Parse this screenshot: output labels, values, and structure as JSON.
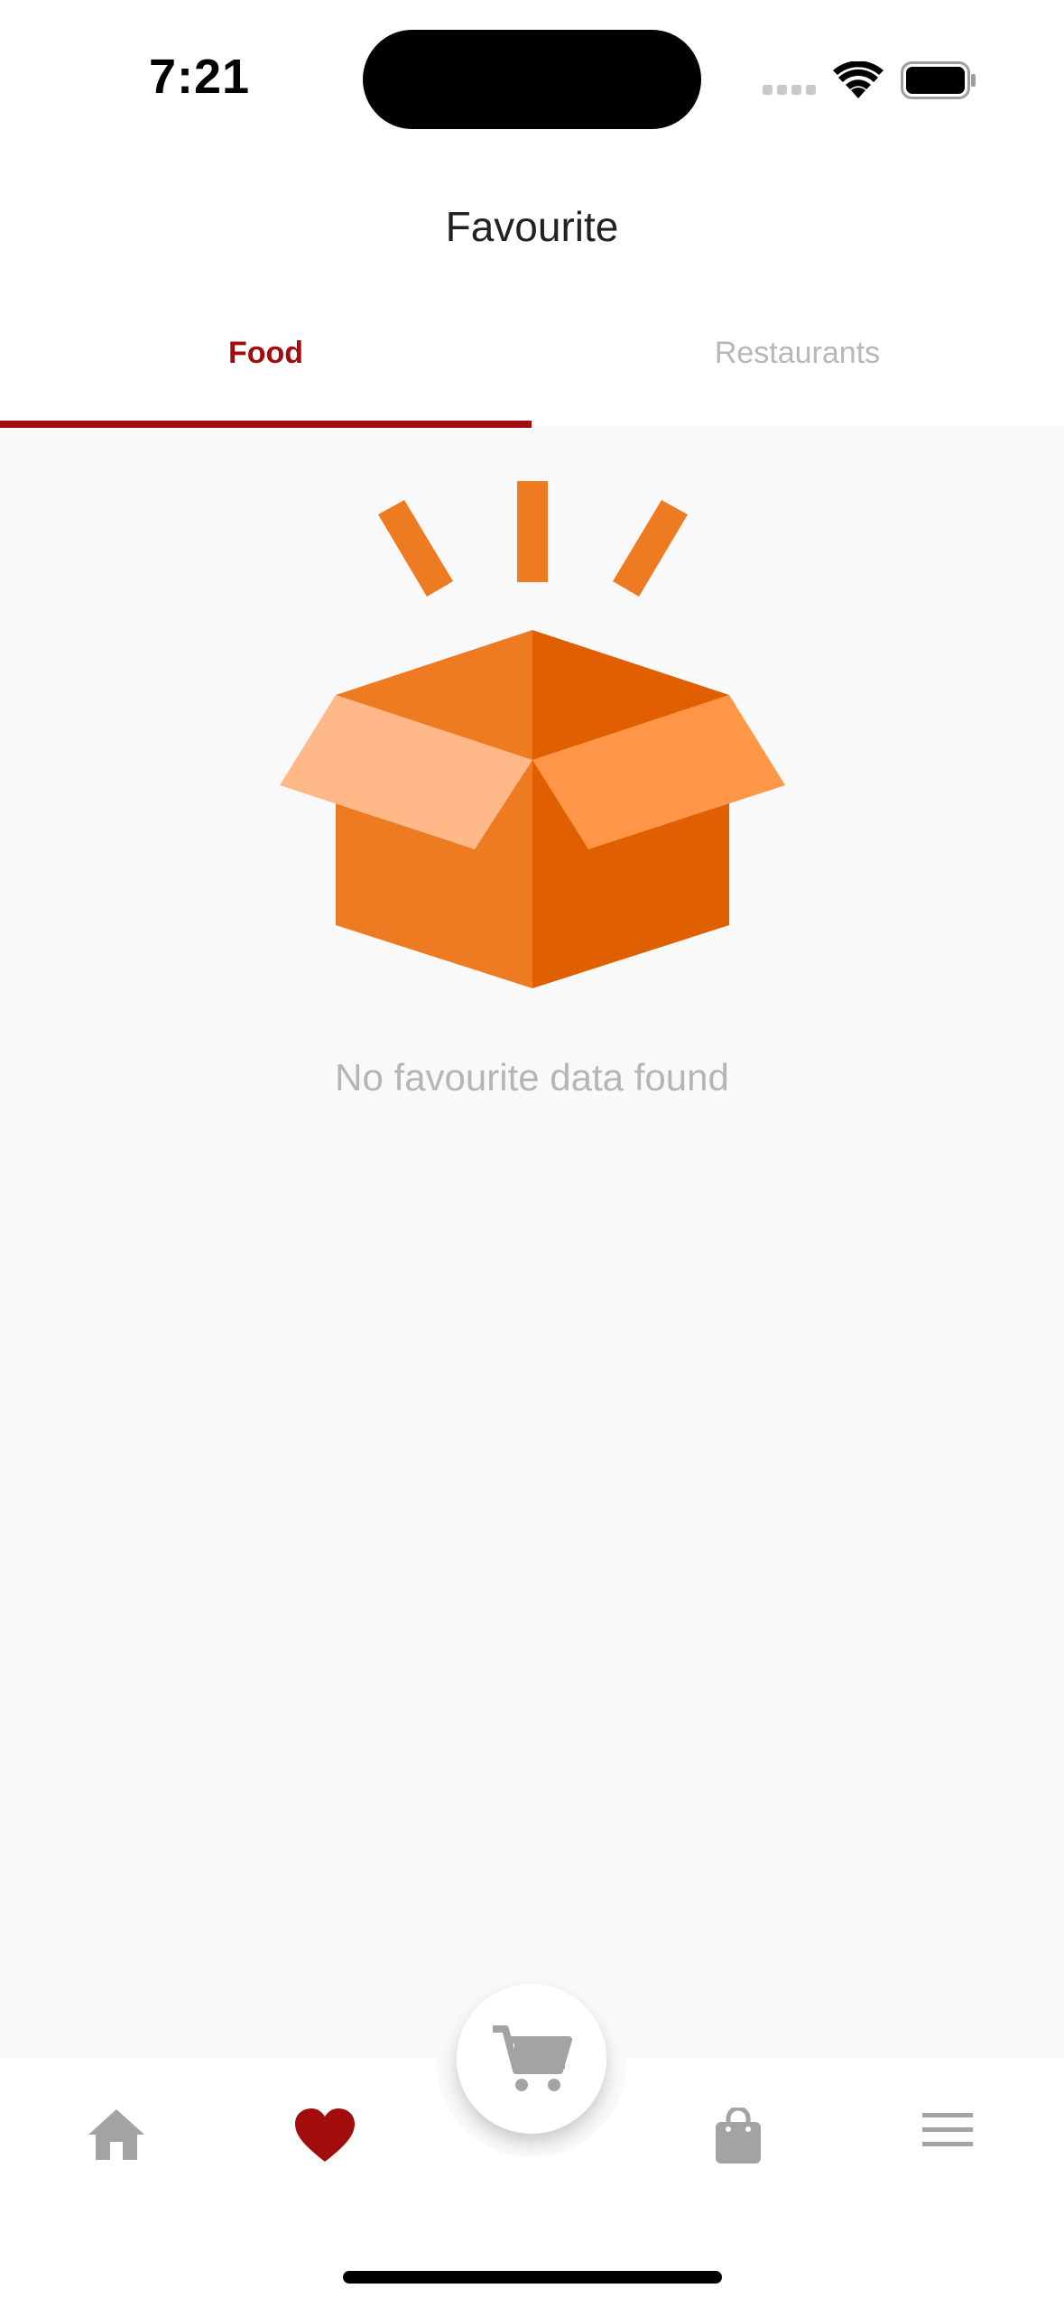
{
  "status_bar": {
    "time": "7:21"
  },
  "header": {
    "title": "Favourite"
  },
  "tabs": [
    {
      "label": "Food",
      "active": true
    },
    {
      "label": "Restaurants",
      "active": false
    }
  ],
  "empty_state": {
    "message": "No favourite data found",
    "illustration": "open-box-icon"
  },
  "bottom_nav": {
    "items": [
      {
        "icon": "home-icon",
        "active": false
      },
      {
        "icon": "heart-icon",
        "active": true
      },
      {
        "icon": "cart-icon",
        "active": false
      },
      {
        "icon": "shopping-bag-icon",
        "active": false
      },
      {
        "icon": "menu-icon",
        "active": false
      }
    ]
  },
  "colors": {
    "accent": "#a30c0c",
    "box_orange": "#ee7b22",
    "inactive_icon": "#a3a3a3",
    "background": "#f9f9f9"
  }
}
